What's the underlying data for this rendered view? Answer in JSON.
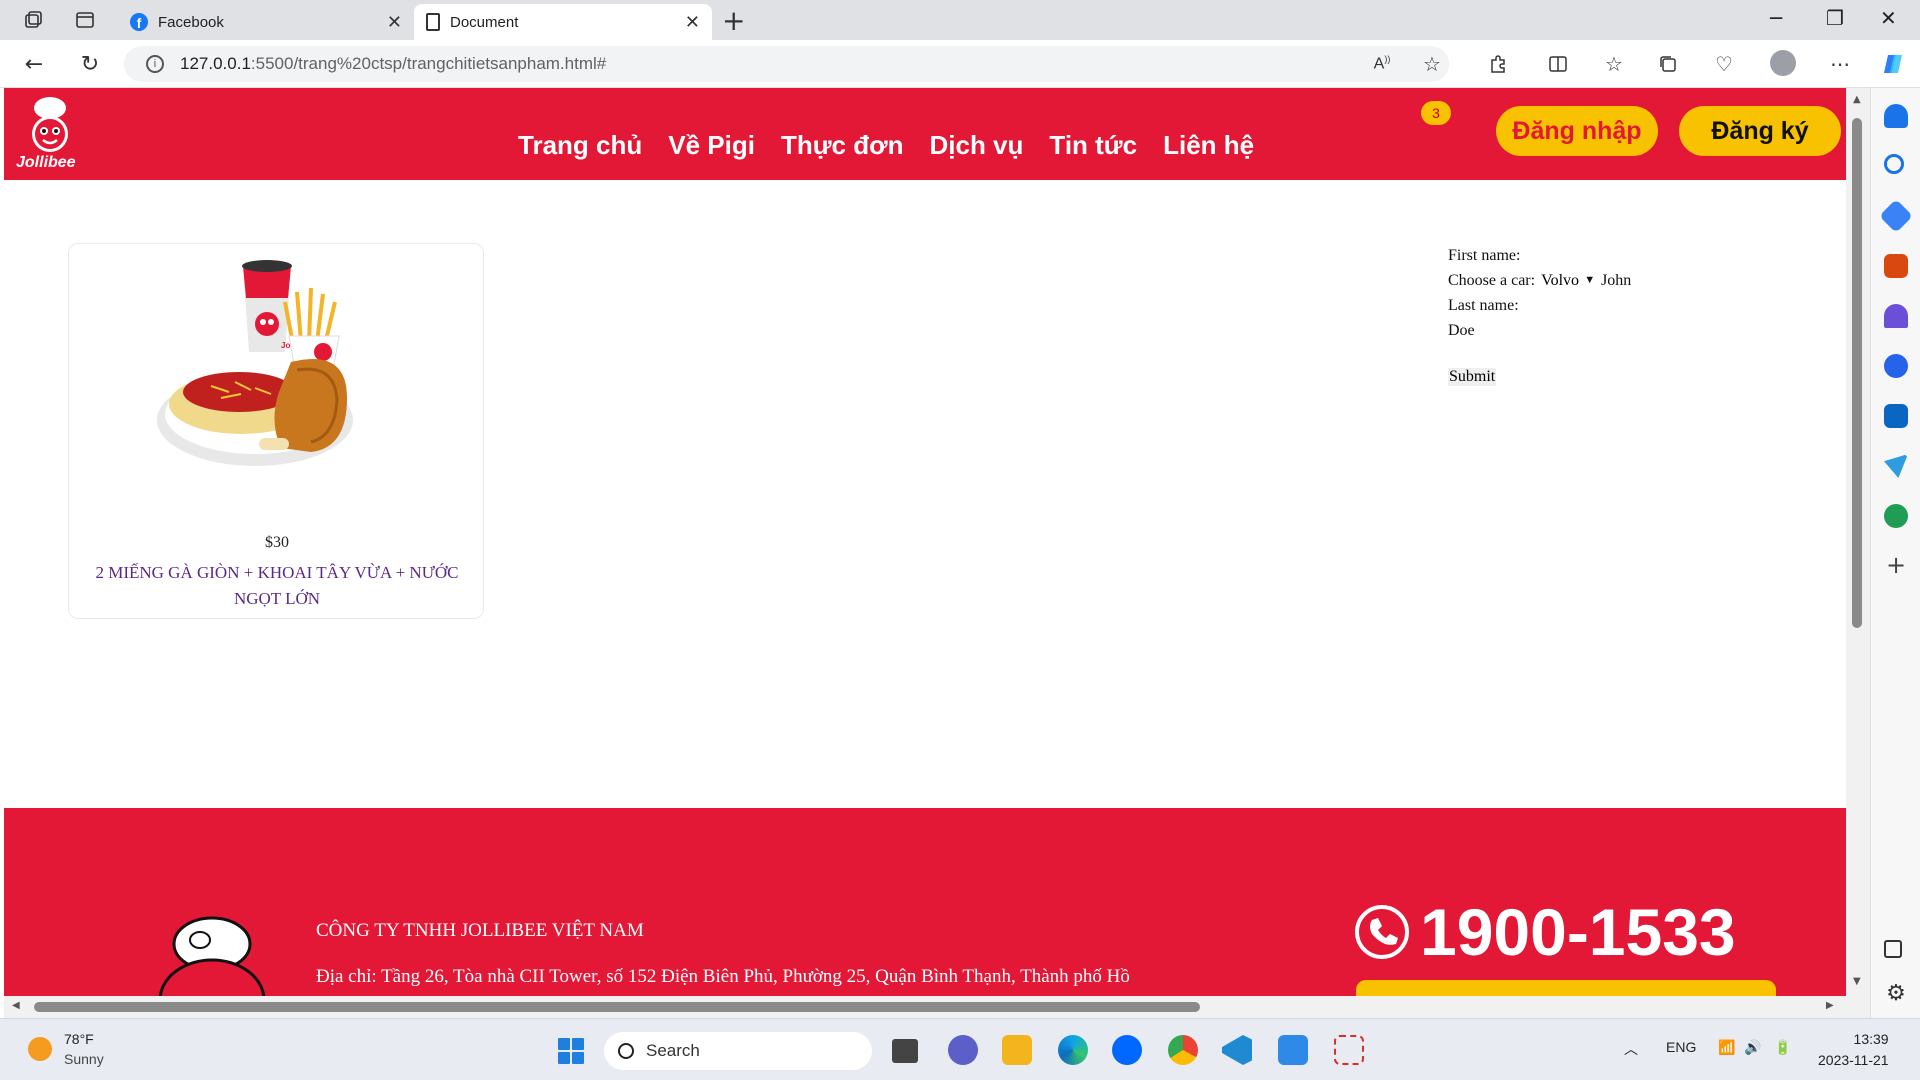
{
  "browser": {
    "tabs": [
      {
        "title": "Facebook",
        "icon": "facebook-icon"
      },
      {
        "title": "Document",
        "icon": "document-icon"
      }
    ],
    "url_host": "127.0.0.1",
    "url_path": ":5500/trang%20ctsp/trangchitietsanpham.html#"
  },
  "header": {
    "logo_text": "Jollibee",
    "nav": [
      "Trang chủ",
      "Về Pigi",
      "Thực đơn",
      "Dịch vụ",
      "Tin tức",
      "Liên hệ"
    ],
    "cart_count": "3",
    "login_label": "Đăng nhập",
    "register_label": "Đăng ký",
    "brand_red": "#e31837",
    "brand_yellow": "#f8c200"
  },
  "product": {
    "price": "$30",
    "name": "2 MIẾNG GÀ GIÒN + KHOAI TÂY VỪA + NƯỚC NGỌT LỚN",
    "image_cup_text": "Jollibee"
  },
  "form": {
    "first_name_label": "First name:",
    "car_label": "Choose a car:",
    "car_selected": "Volvo",
    "first_name_value": "John",
    "last_name_label": "Last name:",
    "last_name_value": "Doe",
    "submit_label": "Submit"
  },
  "footer": {
    "company": "CÔNG TY TNHH JOLLIBEE VIỆT NAM",
    "address": "Địa chỉ: Tầng 26, Tòa nhà CII Tower, số 152 Điện Biên Phủ, Phường 25, Quận Bình Thạnh, Thành phố Hồ",
    "hotline": "1900-1533"
  },
  "taskbar": {
    "temperature": "78°F",
    "condition": "Sunny",
    "search_placeholder": "Search",
    "language": "ENG",
    "time": "13:39",
    "date": "2023-11-21"
  }
}
